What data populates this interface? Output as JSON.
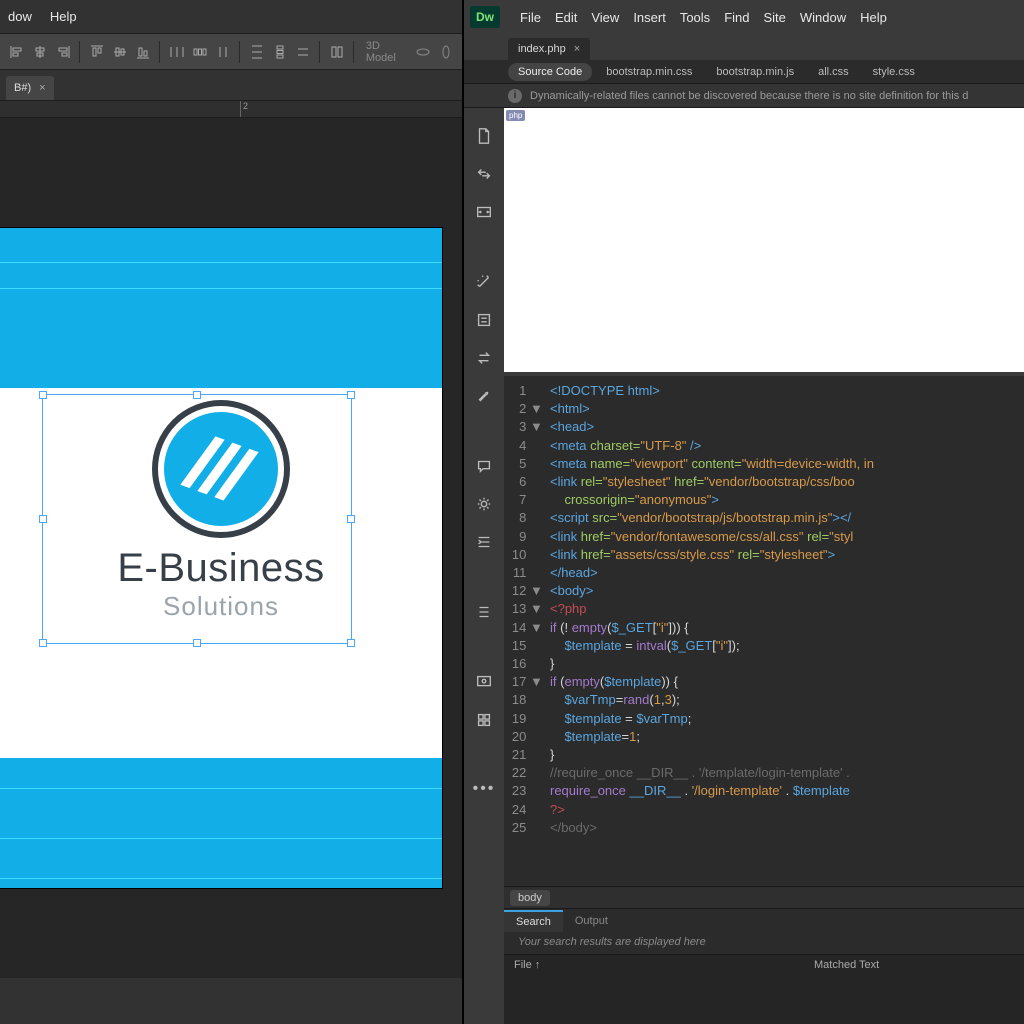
{
  "left": {
    "menu": [
      "dow",
      "Help"
    ],
    "toolbar_label": "3D Model",
    "doc_tab": "B#)",
    "ruler_ticks": [
      {
        "pos": 240,
        "label": "2"
      }
    ],
    "logo": {
      "title": "E-Business",
      "subtitle": "Solutions"
    }
  },
  "dw": {
    "logo": "Dw",
    "menu": [
      "File",
      "Edit",
      "View",
      "Insert",
      "Tools",
      "Find",
      "Site",
      "Window",
      "Help"
    ],
    "file_tab": "index.php",
    "subtabs": [
      "Source Code",
      "bootstrap.min.css",
      "bootstrap.min.js",
      "all.css",
      "style.css"
    ],
    "active_subtab": 0,
    "warning": "Dynamically-related files cannot be discovered because there is no site definition for this d",
    "php_badge": "php",
    "tag_path": "body",
    "bottom_tabs": [
      "Search",
      "Output"
    ],
    "active_bottom_tab": 0,
    "search_msg": "Your search results are displayed here",
    "search_cols": [
      "File ↑",
      "Matched Text"
    ],
    "code_lines": [
      {
        "n": 1,
        "fold": "",
        "html": "<span class='t-tag'>&lt;!DOCTYPE html&gt;</span>"
      },
      {
        "n": 2,
        "fold": "▼",
        "html": "<span class='t-tag'>&lt;html&gt;</span>"
      },
      {
        "n": 3,
        "fold": "▼",
        "html": "<span class='t-tag'>&lt;head&gt;</span>"
      },
      {
        "n": 4,
        "fold": "",
        "html": "<span class='t-tag'>&lt;meta</span> <span class='t-attr'>charset=</span><span class='t-str'>\"UTF-8\"</span> <span class='t-tag'>/&gt;</span>"
      },
      {
        "n": 5,
        "fold": "",
        "html": "<span class='t-tag'>&lt;meta</span> <span class='t-attr'>name=</span><span class='t-str'>\"viewport\"</span> <span class='t-attr'>content=</span><span class='t-str'>\"width=device-width, in</span>"
      },
      {
        "n": 6,
        "fold": "",
        "html": "<span class='t-tag'>&lt;link</span> <span class='t-attr'>rel=</span><span class='t-str'>\"stylesheet\"</span> <span class='t-attr'>href=</span><span class='t-str'>\"vendor/bootstrap/css/boo</span>"
      },
      {
        "n": 7,
        "fold": "",
        "html": "    <span class='t-attr'>crossorigin=</span><span class='t-str'>\"anonymous\"</span><span class='t-tag'>&gt;</span>"
      },
      {
        "n": 8,
        "fold": "",
        "html": "<span class='t-tag'>&lt;script</span> <span class='t-attr'>src=</span><span class='t-str'>\"vendor/bootstrap/js/bootstrap.min.js\"</span><span class='t-tag'>&gt;&lt;/</span>"
      },
      {
        "n": 9,
        "fold": "",
        "html": "<span class='t-tag'>&lt;link</span> <span class='t-attr'>href=</span><span class='t-str'>\"vendor/fontawesome/css/all.css\"</span> <span class='t-attr'>rel=</span><span class='t-str'>\"styl</span>"
      },
      {
        "n": 10,
        "fold": "",
        "html": "<span class='t-tag'>&lt;link</span> <span class='t-attr'>href=</span><span class='t-str'>\"assets/css/style.css\"</span> <span class='t-attr'>rel=</span><span class='t-str'>\"stylesheet\"</span><span class='t-tag'>&gt;</span>"
      },
      {
        "n": 11,
        "fold": "",
        "html": "<span class='t-tag'>&lt;/head&gt;</span>"
      },
      {
        "n": 12,
        "fold": "▼",
        "html": "<span class='t-tag'>&lt;body&gt;</span>"
      },
      {
        "n": 13,
        "fold": "▼",
        "html": "<span class='t-php'>&lt;?php</span>"
      },
      {
        "n": 14,
        "fold": "▼",
        "html": "<span class='t-kw'>if</span> <span class='t-txt'>(!</span> <span class='t-kw'>empty</span><span class='t-txt'>(</span><span class='t-var'>$_GET</span><span class='t-txt'>[</span><span class='t-str'>\"i\"</span><span class='t-txt'>])) {</span>"
      },
      {
        "n": 15,
        "fold": "",
        "html": "    <span class='t-var'>$template</span> <span class='t-txt'>=</span> <span class='t-kw'>intval</span><span class='t-txt'>(</span><span class='t-var'>$_GET</span><span class='t-txt'>[</span><span class='t-str'>\"i\"</span><span class='t-txt'>]);</span>"
      },
      {
        "n": 16,
        "fold": "",
        "html": "<span class='t-txt'>}</span>"
      },
      {
        "n": 17,
        "fold": "▼",
        "html": "<span class='t-kw'>if</span> <span class='t-txt'>(</span><span class='t-kw'>empty</span><span class='t-txt'>(</span><span class='t-var'>$template</span><span class='t-txt'>)) {</span>"
      },
      {
        "n": 18,
        "fold": "",
        "html": "    <span class='t-var'>$varTmp</span><span class='t-txt'>=</span><span class='t-kw'>rand</span><span class='t-txt'>(</span><span class='t-str'>1</span><span class='t-txt'>,</span><span class='t-str'>3</span><span class='t-txt'>);</span>"
      },
      {
        "n": 19,
        "fold": "",
        "html": "    <span class='t-var'>$template</span> <span class='t-txt'>=</span> <span class='t-var'>$varTmp</span><span class='t-txt'>;</span>"
      },
      {
        "n": 20,
        "fold": "",
        "html": "    <span class='t-var'>$template</span><span class='t-txt'>=</span><span class='t-str'>1</span><span class='t-txt'>;</span>"
      },
      {
        "n": 21,
        "fold": "",
        "html": "<span class='t-txt'>}</span>"
      },
      {
        "n": 22,
        "fold": "",
        "html": "<span class='t-com'>//require_once __DIR__ . '/template/login-template' .</span>"
      },
      {
        "n": 23,
        "fold": "",
        "html": "<span class='t-kw'>require_once</span> <span class='t-var'>__DIR__</span> <span class='t-txt'>.</span> <span class='t-str'>'/login-template'</span> <span class='t-txt'>.</span> <span class='t-var'>$template</span>"
      },
      {
        "n": 24,
        "fold": "",
        "html": "<span class='t-php'>?&gt;</span>"
      },
      {
        "n": 25,
        "fold": "",
        "html": "<span class='t-com'>&lt;/body&gt;</span>"
      }
    ]
  }
}
